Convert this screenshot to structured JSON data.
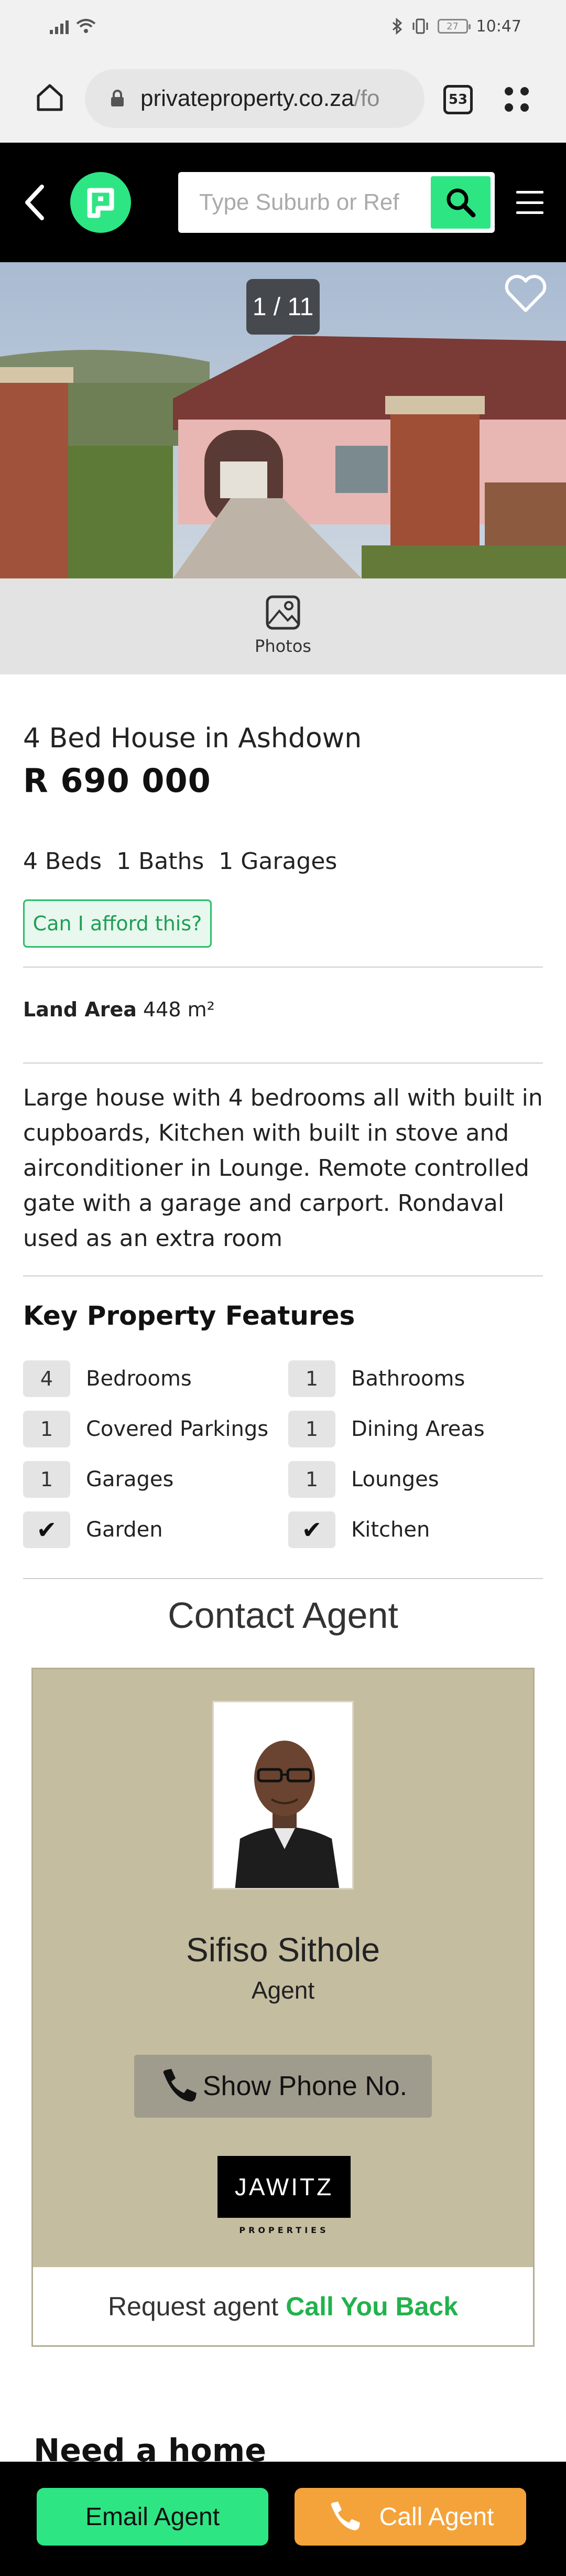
{
  "status_bar": {
    "time": "10:47",
    "battery": "27",
    "icons": [
      "signal-icon",
      "wifi-icon",
      "bluetooth-icon",
      "vibrate-icon",
      "battery-icon"
    ]
  },
  "browser": {
    "url_main": "privateproperty.co.za",
    "url_rest": "/fo",
    "tab_count": "53"
  },
  "header": {
    "search_placeholder": "Type Suburb or Ref",
    "accent_color": "#2ee584"
  },
  "gallery": {
    "counter": "1 / 11",
    "photos_label": "Photos"
  },
  "listing": {
    "title": "4 Bed House in Ashdown",
    "price": "R 690 000",
    "beds": "4 Beds",
    "baths": "1 Baths",
    "garages": "1 Garages",
    "afford_label": "Can I afford this?",
    "land_area_label": "Land Area",
    "land_area_value": "448 m²",
    "description": "Large house with 4 bedrooms all with built in cupboards, Kitchen with built in stove and airconditioner in Lounge. Remote controlled gate with a garage and carport. Rondaval used as an extra room"
  },
  "features": {
    "title": "Key Property Features",
    "items": [
      {
        "count": "4",
        "label": "Bedrooms"
      },
      {
        "count": "1",
        "label": "Bathrooms"
      },
      {
        "count": "1",
        "label": "Covered Parkings"
      },
      {
        "count": "1",
        "label": "Dining Areas"
      },
      {
        "count": "1",
        "label": "Garages"
      },
      {
        "count": "1",
        "label": "Lounges"
      },
      {
        "count": "✔",
        "label": "Garden"
      },
      {
        "count": "✔",
        "label": "Kitchen"
      }
    ]
  },
  "contact": {
    "title": "Contact Agent",
    "agent_name": "Sifiso Sithole",
    "agent_role": "Agent",
    "phone_label": "Show Phone No.",
    "agency_name": "JAWITZ",
    "agency_sub": "PROPERTIES",
    "callback_prefix": "Request agent",
    "callback_action": "Call You Back"
  },
  "teaser": "Need a home",
  "actions": {
    "email_label": "Email Agent",
    "call_label": "Call Agent",
    "email_color": "#2ee584",
    "call_color": "#f4a33a"
  }
}
